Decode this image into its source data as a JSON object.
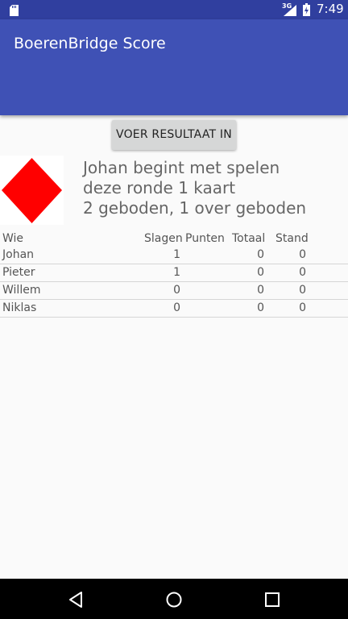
{
  "status_bar": {
    "network_type": "3G",
    "time": "7:49",
    "icons": [
      "sd-card-icon",
      "cell-signal-icon",
      "battery-charging-icon"
    ]
  },
  "app_bar": {
    "title": "BoerenBridge Score"
  },
  "actions": {
    "enter_result_label": "VOER RESULTAAT IN"
  },
  "round": {
    "trump_suit": "diamonds",
    "trump_color": "#ff0000",
    "line1": "Johan begint met spelen",
    "line2": "deze ronde 1 kaart",
    "line3": "2 geboden, 1 over geboden"
  },
  "table": {
    "headers": {
      "name": "Wie",
      "slagen": "Slagen",
      "punten": "Punten",
      "totaal": "Totaal",
      "stand": "Stand"
    },
    "rows": [
      {
        "name": "Johan",
        "slagen": "1",
        "punten": "",
        "totaal": "0",
        "stand": "0"
      },
      {
        "name": "Pieter",
        "slagen": "1",
        "punten": "",
        "totaal": "0",
        "stand": "0"
      },
      {
        "name": "Willem",
        "slagen": "0",
        "punten": "",
        "totaal": "0",
        "stand": "0"
      },
      {
        "name": "Niklas",
        "slagen": "0",
        "punten": "",
        "totaal": "0",
        "stand": "0"
      }
    ]
  },
  "colors": {
    "primary": "#3f51b5",
    "primary_dark": "#303f9f",
    "button": "#d6d7d7"
  },
  "nav_bar": {
    "icons": [
      "back-icon",
      "home-icon",
      "recents-icon"
    ]
  }
}
